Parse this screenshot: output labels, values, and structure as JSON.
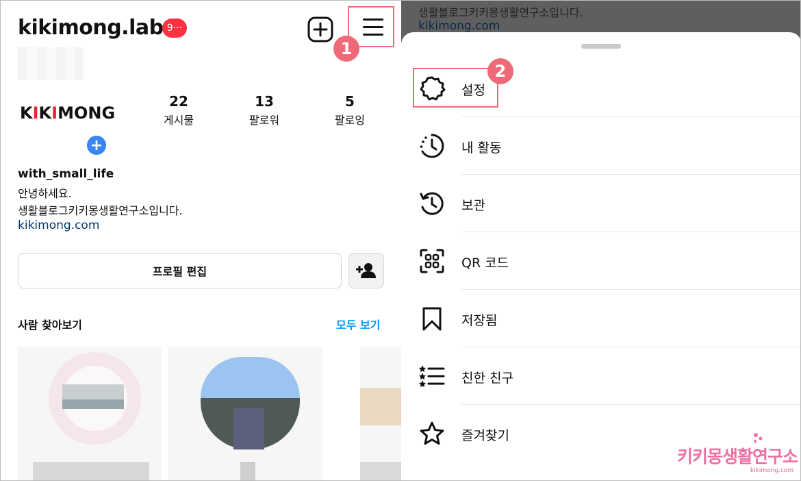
{
  "left": {
    "username": "kikimong.lab",
    "notification_badge": "9···",
    "logo": {
      "part1": "K",
      "part2": "I",
      "part3": "K",
      "part4": "I",
      "part5": "MONG"
    },
    "stats": [
      {
        "value": "22",
        "label": "게시물"
      },
      {
        "value": "13",
        "label": "팔로워"
      },
      {
        "value": "5",
        "label": "팔로잉"
      }
    ],
    "bio": {
      "name": "with_small_life",
      "line1": "안녕하세요.",
      "line2": "생활블로그키키몽생활연구소입니다.",
      "link": "kikimong.com"
    },
    "edit_profile_label": "프로필 편집",
    "discover_title": "사람 찾아보기",
    "see_all_label": "모두 보기",
    "step1": "1"
  },
  "right": {
    "behind_text1": "생활블로그키키몽생활연구소입니다.",
    "behind_link": "kikimong.com",
    "step2": "2",
    "menu": [
      {
        "label": "설정",
        "icon": "settings-gear-icon"
      },
      {
        "label": "내 활동",
        "icon": "activity-clock-icon"
      },
      {
        "label": "보관",
        "icon": "archive-history-icon"
      },
      {
        "label": "QR 코드",
        "icon": "qr-code-icon"
      },
      {
        "label": "저장됨",
        "icon": "bookmark-icon"
      },
      {
        "label": "친한 친구",
        "icon": "close-friends-list-icon"
      },
      {
        "label": "즐겨찾기",
        "icon": "star-icon"
      }
    ]
  },
  "watermark": {
    "text": "키키몽생활연구소",
    "sub": "kikimong.com"
  },
  "colors": {
    "accent_highlight": "#ee6b77",
    "badge_red": "#ff3040",
    "link_blue": "#0095f6",
    "logo_red": "#e3262f"
  }
}
